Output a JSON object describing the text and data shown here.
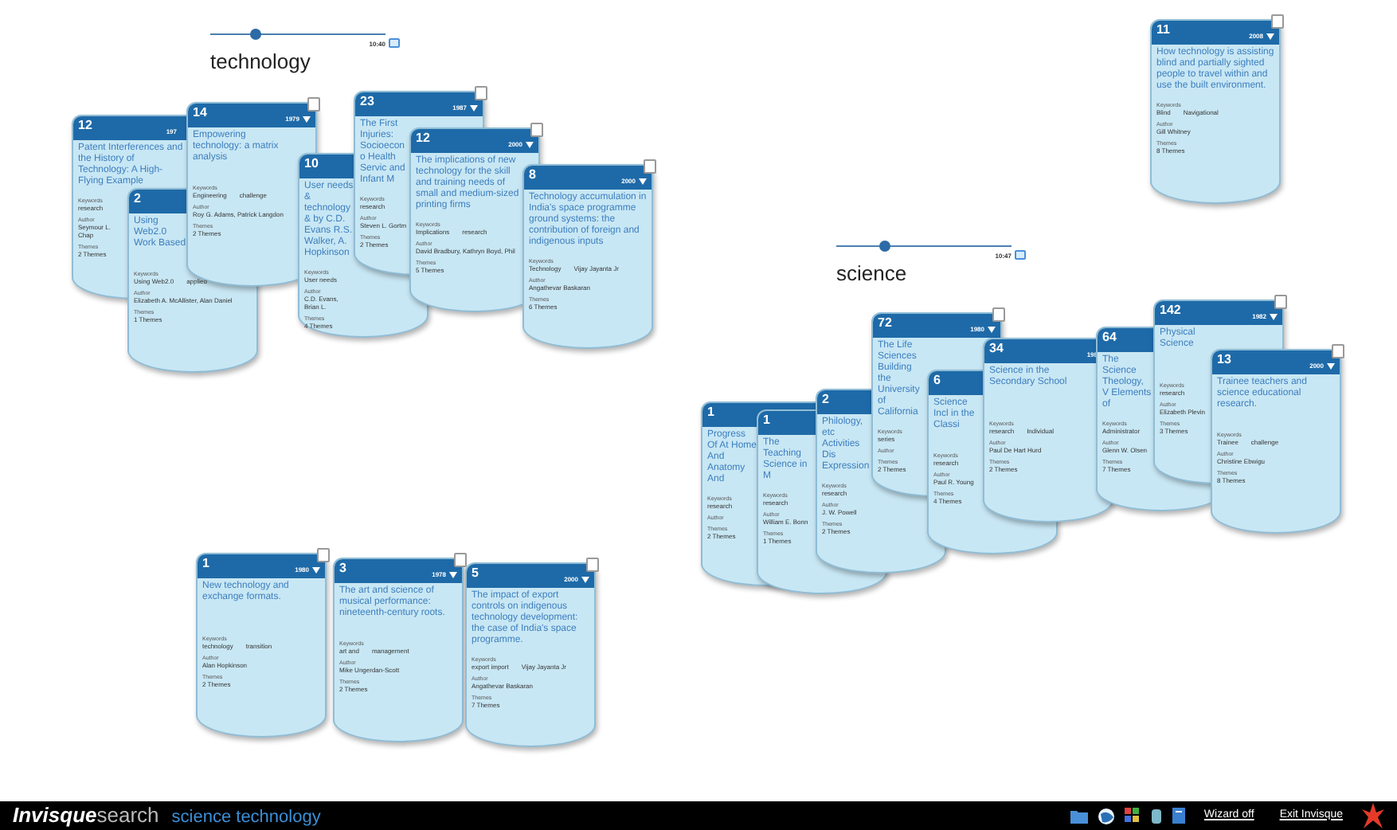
{
  "topic_groups": [
    {
      "heading": "technology",
      "time": "10:40",
      "level": 0.25,
      "cards": [
        {
          "count": "12",
          "year": "197",
          "title": "Patent Interferences and the History of Technology: A High-Flying Example",
          "fields": [
            {
              "label": "Keywords",
              "values": [
                "research"
              ]
            },
            {
              "label": "Author",
              "values": [
                "Seymour L. Chap"
              ]
            },
            {
              "label": "Themes",
              "values": [
                "2 Themes"
              ]
            }
          ]
        },
        {
          "count": "2",
          "title": "Using Web2.0 Work Based",
          "fields": [
            {
              "label": "Keywords",
              "values": [
                "Using Web2.0",
                "applied"
              ]
            },
            {
              "label": "Author",
              "values": [
                "Elizabeth A. McAllister, Alan Daniel"
              ]
            },
            {
              "label": "Themes",
              "values": [
                "1 Themes"
              ]
            }
          ]
        },
        {
          "count": "14",
          "year": "1979",
          "title": "Empowering technology: a matrix analysis",
          "fields": [
            {
              "label": "Keywords",
              "values": [
                "Engineering",
                "challenge"
              ]
            },
            {
              "label": "Author",
              "values": [
                "Roy G. Adams, Patrick Langdon"
              ]
            },
            {
              "label": "Themes",
              "values": [
                "2 Themes"
              ]
            }
          ]
        },
        {
          "count": "10",
          "title": "User needs & technology & by C.D. Evans R.S. Walker, A. Hopkinson",
          "fields": [
            {
              "label": "Keywords",
              "values": [
                "User needs"
              ]
            },
            {
              "label": "Author",
              "values": [
                "C.D. Evans, Brian L."
              ]
            },
            {
              "label": "Themes",
              "values": [
                "4 Themes"
              ]
            }
          ]
        },
        {
          "count": "23",
          "year": "1987",
          "title": "The First Injuries: Socioecono Health Servic and Infant M",
          "fields": [
            {
              "label": "Keywords",
              "values": [
                "research"
              ]
            },
            {
              "label": "Author",
              "values": [
                "Steven L. Gortm"
              ]
            },
            {
              "label": "Themes",
              "values": [
                "2 Themes"
              ]
            }
          ]
        },
        {
          "count": "12",
          "year": "2000",
          "title": "The implications of new technology for the skill and training needs of small and medium-sized printing firms",
          "fields": [
            {
              "label": "Keywords",
              "values": [
                "Implications",
                "research"
              ]
            },
            {
              "label": "Author",
              "values": [
                "David Bradbury, Kathryn Boyd, Phil"
              ]
            },
            {
              "label": "Themes",
              "values": [
                "5 Themes"
              ]
            }
          ]
        },
        {
          "count": "8",
          "year": "2000",
          "title": "Technology accumulation in India's space programme ground systems: the contribution of foreign and indigenous inputs",
          "fields": [
            {
              "label": "Keywords",
              "values": [
                "Technology",
                "Vijay Jayanta Jr"
              ]
            },
            {
              "label": "Author",
              "values": [
                "Angathevar Baskaran"
              ]
            },
            {
              "label": "Themes",
              "values": [
                "6 Themes"
              ]
            }
          ]
        }
      ]
    },
    {
      "heading": "science",
      "time": "10:47",
      "level": 0.27,
      "cards": [
        {
          "count": "1",
          "title": "Progress Of At Home And Anatomy And",
          "fields": [
            {
              "label": "Keywords",
              "values": [
                "research"
              ]
            },
            {
              "label": "Author"
            },
            {
              "label": "Themes",
              "values": [
                "2 Themes"
              ]
            }
          ]
        },
        {
          "count": "1",
          "title": "The Teaching Science in M",
          "fields": [
            {
              "label": "Keywords",
              "values": [
                "research"
              ]
            },
            {
              "label": "Author",
              "values": [
                "William E. Bonn"
              ]
            },
            {
              "label": "Themes",
              "values": [
                "1 Themes"
              ]
            }
          ]
        },
        {
          "count": "2",
          "title": "Philology, etc Activities Dis Expression",
          "fields": [
            {
              "label": "Keywords",
              "values": [
                "research"
              ]
            },
            {
              "label": "Author",
              "values": [
                "J. W. Powell"
              ]
            },
            {
              "label": "Themes",
              "values": [
                "2 Themes"
              ]
            }
          ]
        },
        {
          "count": "72",
          "year": "1980",
          "title": "The Life Sciences Building the University of California",
          "fields": [
            {
              "label": "Keywords",
              "values": [
                "series"
              ]
            },
            {
              "label": "Author"
            },
            {
              "label": "Themes",
              "values": [
                "2 Themes"
              ]
            }
          ]
        },
        {
          "count": "6",
          "title": "Science Incl in the Classi",
          "fields": [
            {
              "label": "Keywords",
              "values": [
                "research"
              ]
            },
            {
              "label": "Author",
              "values": [
                "Paul R. Young"
              ]
            },
            {
              "label": "Themes",
              "values": [
                "4 Themes"
              ]
            }
          ]
        },
        {
          "count": "34",
          "year": "198",
          "title": "Science in the Secondary School",
          "fields": [
            {
              "label": "Keywords",
              "values": [
                "research",
                "Individual"
              ]
            },
            {
              "label": "Author",
              "values": [
                "Paul De Hart Hurd"
              ]
            },
            {
              "label": "Themes",
              "values": [
                "2 Themes"
              ]
            }
          ]
        },
        {
          "count": "64",
          "title": "The Science Theology, V Elements of",
          "fields": [
            {
              "label": "Keywords",
              "values": [
                "Administrator"
              ]
            },
            {
              "label": "Author",
              "values": [
                "Glenn W. Olsen"
              ]
            },
            {
              "label": "Themes",
              "values": [
                "7 Themes"
              ]
            }
          ]
        },
        {
          "count": "142",
          "year": "1982",
          "title": "Physical Science",
          "fields": [
            {
              "label": "Keywords",
              "values": [
                "research"
              ]
            },
            {
              "label": "Author",
              "values": [
                "Elizabeth Plevin"
              ]
            },
            {
              "label": "Themes",
              "values": [
                "3 Themes"
              ]
            }
          ]
        },
        {
          "count": "13",
          "year": "2000",
          "title": "Trainee teachers and science educational research.",
          "fields": [
            {
              "label": "Keywords",
              "values": [
                "Trainee",
                "challenge"
              ]
            },
            {
              "label": "Author",
              "values": [
                "Christine Ebwigu"
              ]
            },
            {
              "label": "Themes",
              "values": [
                "8 Themes"
              ]
            }
          ]
        }
      ]
    }
  ],
  "loose_cards": [
    {
      "count": "11",
      "year": "2008",
      "title": "How technology is assisting blind and partially sighted people to travel within and use the built environment.",
      "fields": [
        {
          "label": "Keywords",
          "values": [
            "Blind",
            "Navigational"
          ]
        },
        {
          "label": "Author",
          "values": [
            "Gill Whitney"
          ]
        },
        {
          "label": "Themes",
          "values": [
            "8 Themes"
          ]
        }
      ]
    },
    {
      "count": "1",
      "year": "1980",
      "title": "New technology and exchange formats.",
      "fields": [
        {
          "label": "Keywords",
          "values": [
            "technology",
            "transition"
          ]
        },
        {
          "label": "Author",
          "values": [
            "Alan Hopkinson"
          ]
        },
        {
          "label": "Themes",
          "values": [
            "2 Themes"
          ]
        }
      ]
    },
    {
      "count": "3",
      "year": "1978",
      "title": "The art and science of musical performance: nineteenth-century roots.",
      "fields": [
        {
          "label": "Keywords",
          "values": [
            "art and",
            "management"
          ]
        },
        {
          "label": "Author",
          "values": [
            "Mike Ungerdan-Scott"
          ]
        },
        {
          "label": "Themes",
          "values": [
            "2 Themes"
          ]
        }
      ]
    },
    {
      "count": "5",
      "year": "2000",
      "title": "The impact of export controls on indigenous technology development: the case of India's space programme.",
      "fields": [
        {
          "label": "Keywords",
          "values": [
            "export import",
            "Vijay Jayanta Jr"
          ]
        },
        {
          "label": "Author",
          "values": [
            "Angathevar Baskaran"
          ]
        },
        {
          "label": "Themes",
          "values": [
            "7 Themes"
          ]
        }
      ]
    }
  ],
  "bottom_bar": {
    "brand_bold": "Invisque",
    "brand_rest": "search",
    "query": "science technology",
    "links": [
      "Wizard off",
      "Exit Invisque"
    ]
  }
}
